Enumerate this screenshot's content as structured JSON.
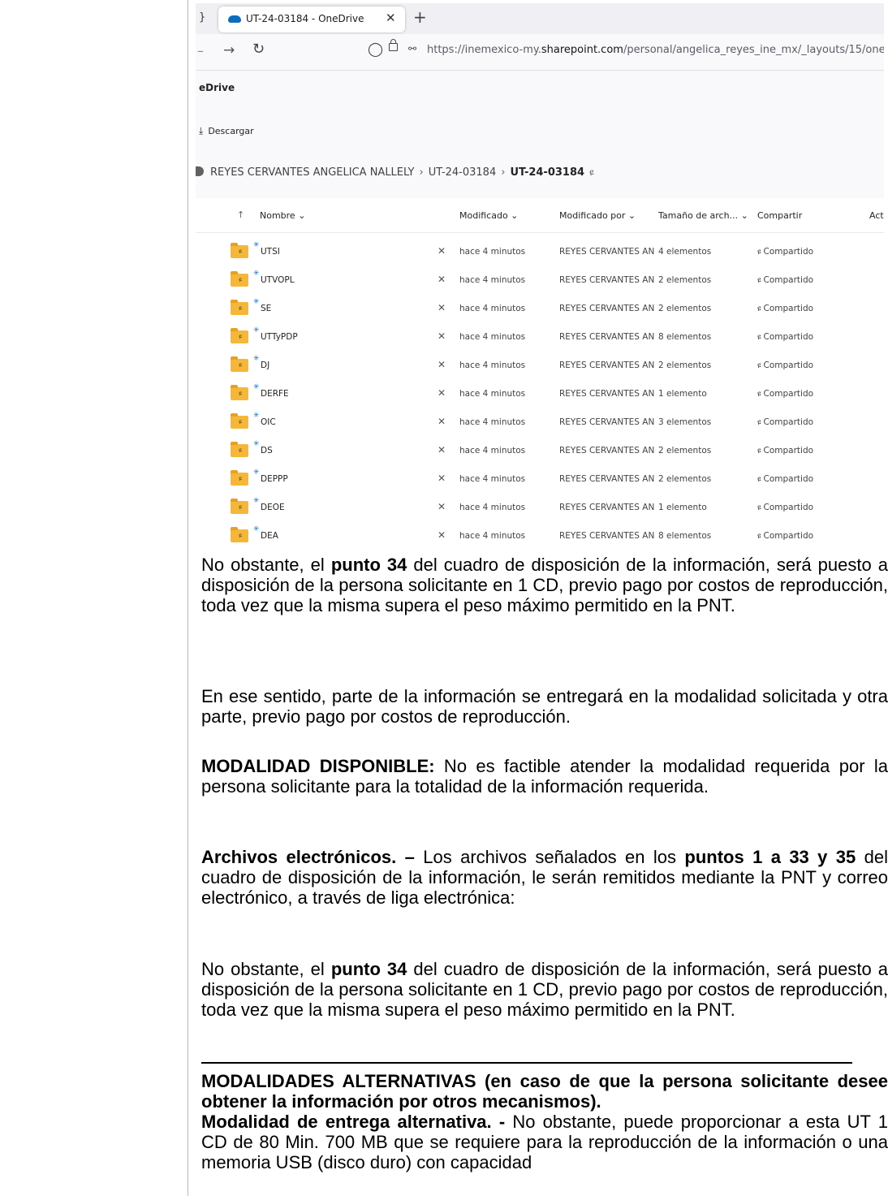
{
  "browser": {
    "prev_tab_fragment": "}",
    "tab_title": "UT-24-03184 - OneDrive",
    "tab_close": "✕",
    "new_tab": "+",
    "url_prefix": "https://inemexico-my.",
    "url_domain": "sharepoint.com",
    "url_path": "/personal/angelica_reyes_ine_mx/_layouts/15/one"
  },
  "onedrive": {
    "brand": "eDrive",
    "download_label": "Descargar",
    "breadcrumb": [
      "REYES CERVANTES ANGELICA NALLELY",
      "UT-24-03184",
      "UT-24-03184"
    ],
    "columns": {
      "sort": "↑",
      "name": "Nombre ⌄",
      "modified": "Modificado ⌄",
      "modified_by": "Modificado por ⌄",
      "size": "Tamaño de arch... ⌄",
      "share": "Compartir",
      "activity": "Act"
    },
    "rows": [
      {
        "name": "UTSI",
        "modified": "hace 4 minutos",
        "by": "REYES CERVANTES AN",
        "size": "4 elementos",
        "share": "Compartido"
      },
      {
        "name": "UTVOPL",
        "modified": "hace 4 minutos",
        "by": "REYES CERVANTES AN",
        "size": "2 elementos",
        "share": "Compartido"
      },
      {
        "name": "SE",
        "modified": "hace 4 minutos",
        "by": "REYES CERVANTES AN",
        "size": "2 elementos",
        "share": "Compartido"
      },
      {
        "name": "UTTyPDP",
        "modified": "hace 4 minutos",
        "by": "REYES CERVANTES AN",
        "size": "8 elementos",
        "share": "Compartido"
      },
      {
        "name": "DJ",
        "modified": "hace 4 minutos",
        "by": "REYES CERVANTES AN",
        "size": "2 elementos",
        "share": "Compartido"
      },
      {
        "name": "DERFE",
        "modified": "hace 4 minutos",
        "by": "REYES CERVANTES AN",
        "size": "1 elemento",
        "share": "Compartido"
      },
      {
        "name": "OIC",
        "modified": "hace 4 minutos",
        "by": "REYES CERVANTES AN",
        "size": "3 elementos",
        "share": "Compartido"
      },
      {
        "name": "DS",
        "modified": "hace 4 minutos",
        "by": "REYES CERVANTES AN",
        "size": "2 elementos",
        "share": "Compartido"
      },
      {
        "name": "DEPPP",
        "modified": "hace 4 minutos",
        "by": "REYES CERVANTES AN",
        "size": "2 elementos",
        "share": "Compartido"
      },
      {
        "name": "DEOE",
        "modified": "hace 4 minutos",
        "by": "REYES CERVANTES AN",
        "size": "1 elemento",
        "share": "Compartido"
      },
      {
        "name": "DEA",
        "modified": "hace 4 minutos",
        "by": "REYES CERVANTES AN",
        "size": "8 elementos",
        "share": "Compartido"
      }
    ]
  },
  "document": {
    "p1": {
      "a": "No obstante, el ",
      "b": "punto 34",
      "c": " del cuadro de disposición de la información, será puesto a disposición de la persona solicitante en 1 CD, previo pago por costos de reproducción, toda vez que la misma supera el peso máximo permitido en la PNT."
    },
    "p2": "En ese sentido, parte de la información se entregará en la modalidad solicitada y otra parte, previo pago por costos de reproducción.",
    "p3": {
      "a": "MODALIDAD DISPONIBLE:",
      "b": " No es factible atender la modalidad requerida por la persona solicitante para la totalidad de la información requerida."
    },
    "p4": {
      "a": "Archivos electrónicos. –",
      "b": " Los archivos señalados en los ",
      "c": "puntos 1 a 33 y 35",
      "d": " del cuadro de disposición de la información, le serán remitidos mediante la PNT y correo electrónico, a través de liga electrónica:"
    },
    "p5": {
      "a": "No obstante, el ",
      "b": "punto 34",
      "c": " del cuadro de disposición de la información, será puesto a disposición de la persona solicitante en 1 CD, previo pago por costos de reproducción, toda vez que la misma supera el peso máximo permitido en la PNT."
    },
    "p6": {
      "a": "MODALIDADES ALTERNATIVAS (en caso de que la persona solicitante desee obtener la información por otros mecanismos).",
      "b": "Modalidad de entrega alternativa. -",
      "c": " No obstante, puede proporcionar a esta UT 1 CD de 80 Min. 700 MB que se requiere para la reproducción de la información o una memoria USB (disco duro) con capacidad"
    }
  }
}
